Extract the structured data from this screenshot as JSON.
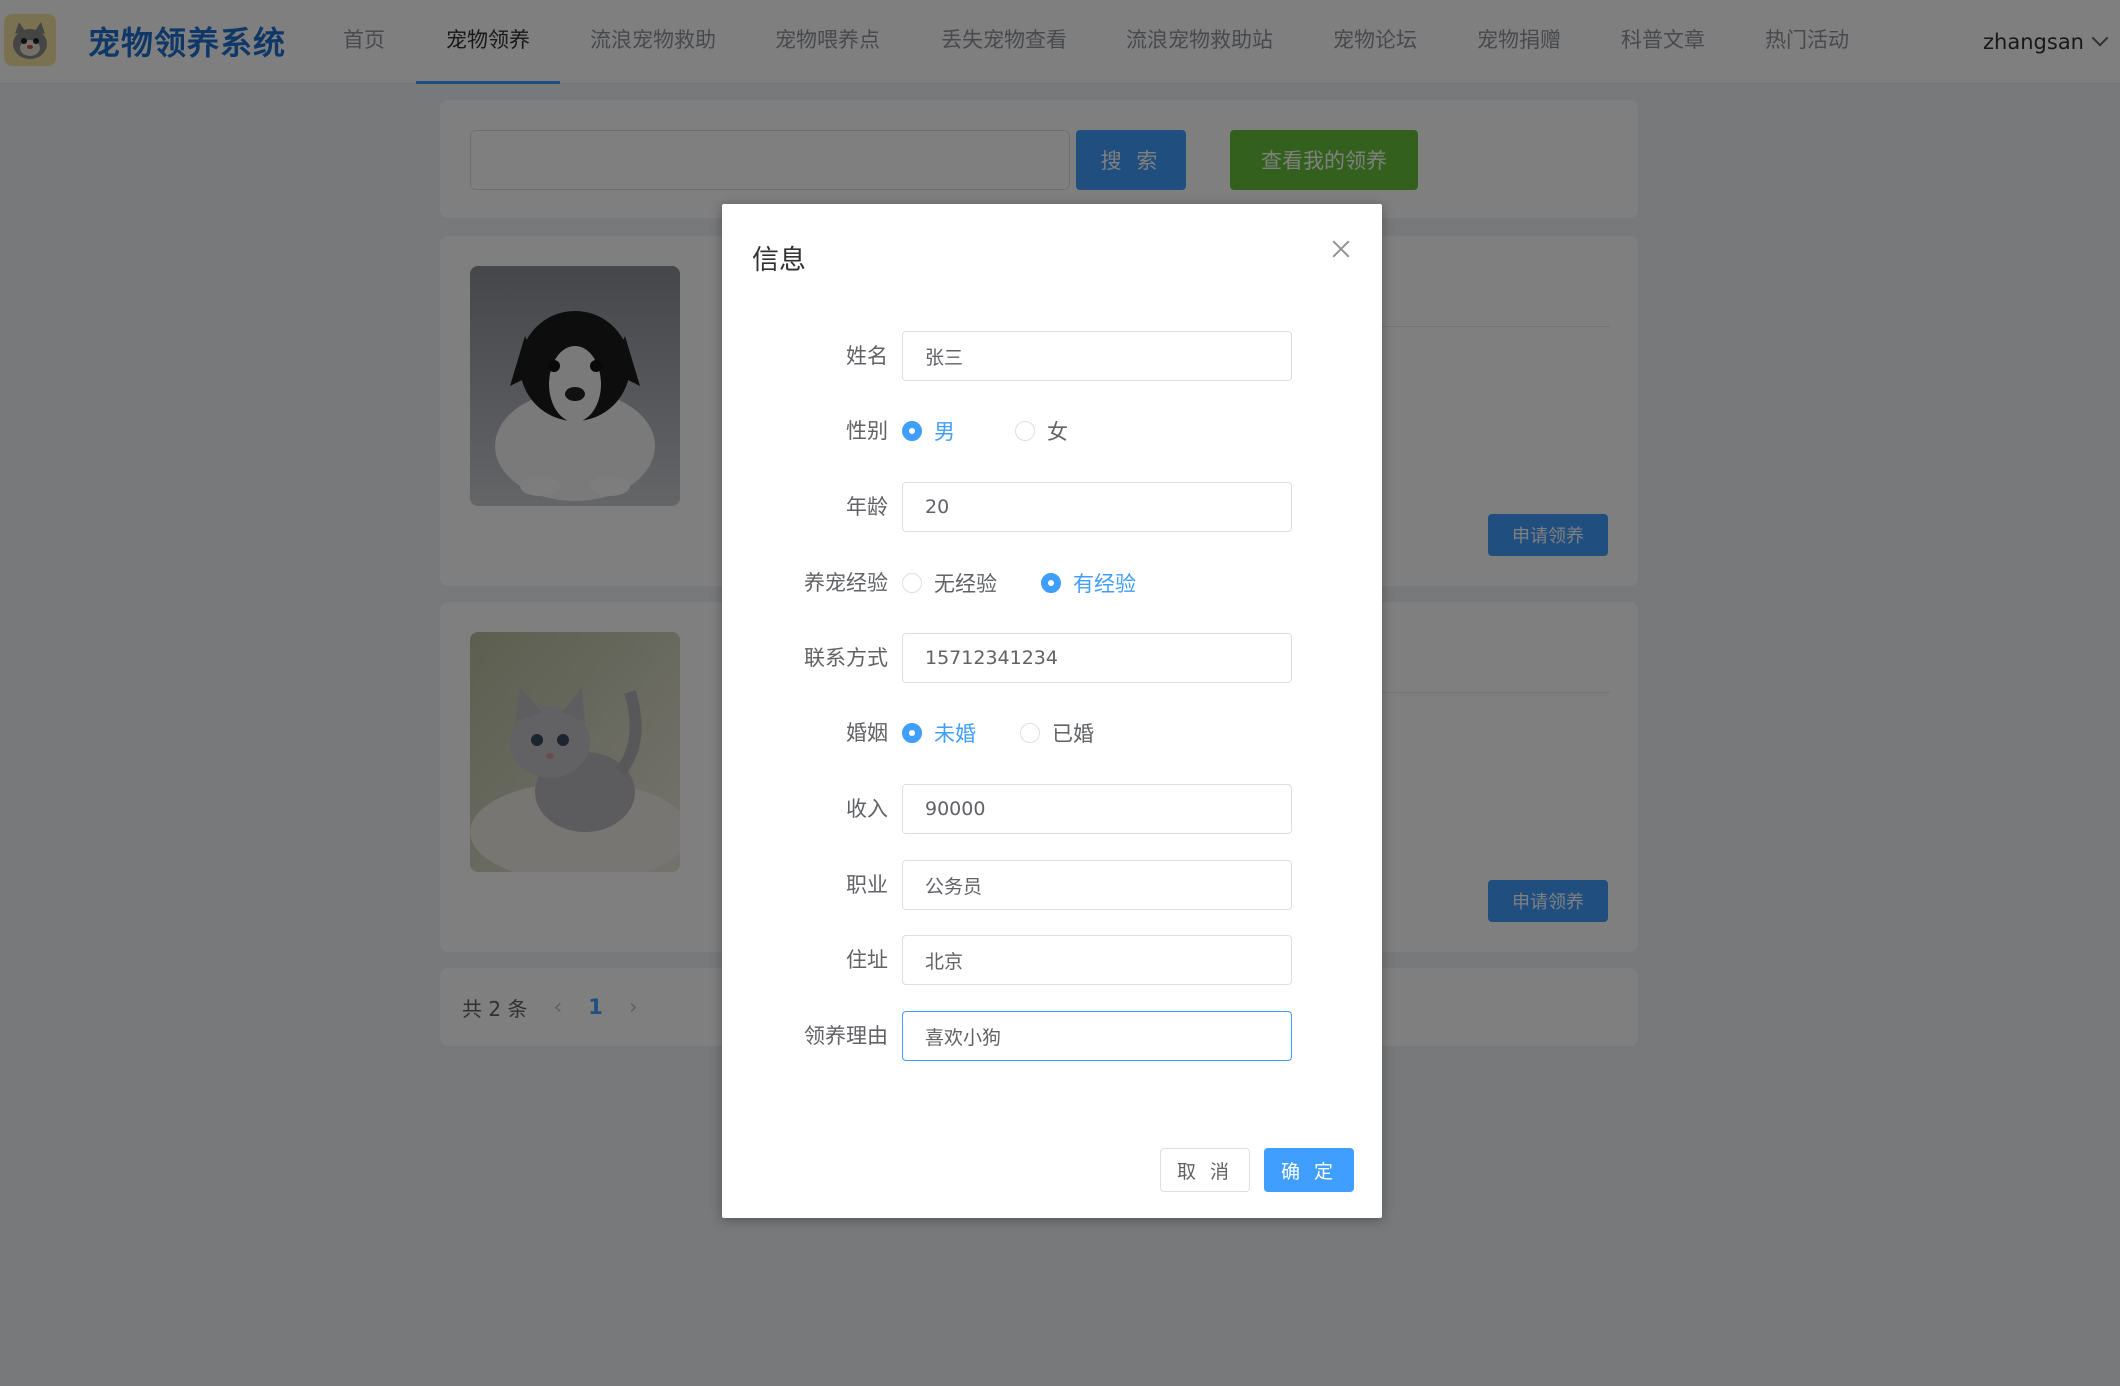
{
  "header": {
    "logo_title": "宠物领养系统",
    "nav": [
      {
        "label": "首页",
        "active": false
      },
      {
        "label": "宠物领养",
        "active": true
      },
      {
        "label": "流浪宠物救助",
        "active": false
      },
      {
        "label": "宠物喂养点",
        "active": false
      },
      {
        "label": "丢失宠物查看",
        "active": false
      },
      {
        "label": "流浪宠物救助站",
        "active": false
      },
      {
        "label": "宠物论坛",
        "active": false
      },
      {
        "label": "宠物捐赠",
        "active": false
      },
      {
        "label": "科普文章",
        "active": false
      },
      {
        "label": "热门活动",
        "active": false
      }
    ],
    "username": "zhangsan"
  },
  "search": {
    "value": "",
    "button_label": "搜 索",
    "my_adoption_label": "查看我的领养"
  },
  "pets": [
    {
      "photo": "puppy-photo",
      "apply_label": "申请领养"
    },
    {
      "photo": "kitten-photo",
      "apply_label": "申请领养"
    }
  ],
  "pagination": {
    "total_text": "共 2 条",
    "prev": "‹",
    "current_page": "1",
    "next": "›"
  },
  "dialog": {
    "title": "信息",
    "fields": {
      "name": {
        "label": "姓名",
        "value": "张三"
      },
      "gender": {
        "label": "性别",
        "options": [
          "男",
          "女"
        ],
        "selected": "男"
      },
      "age": {
        "label": "年龄",
        "value": "20"
      },
      "experience": {
        "label": "养宠经验",
        "options": [
          "无经验",
          "有经验"
        ],
        "selected": "有经验"
      },
      "contact": {
        "label": "联系方式",
        "value": "15712341234"
      },
      "marriage": {
        "label": "婚姻",
        "options": [
          "未婚",
          "已婚"
        ],
        "selected": "未婚"
      },
      "income": {
        "label": "收入",
        "value": "90000"
      },
      "occupation": {
        "label": "职业",
        "value": "公务员"
      },
      "address": {
        "label": "住址",
        "value": "北京"
      },
      "reason": {
        "label": "领养理由",
        "value": "喜欢小狗"
      }
    },
    "cancel_label": "取 消",
    "ok_label": "确 定"
  },
  "colors": {
    "primary": "#409eff",
    "success": "#67c23a",
    "brand_title": "#1f6fd1"
  }
}
